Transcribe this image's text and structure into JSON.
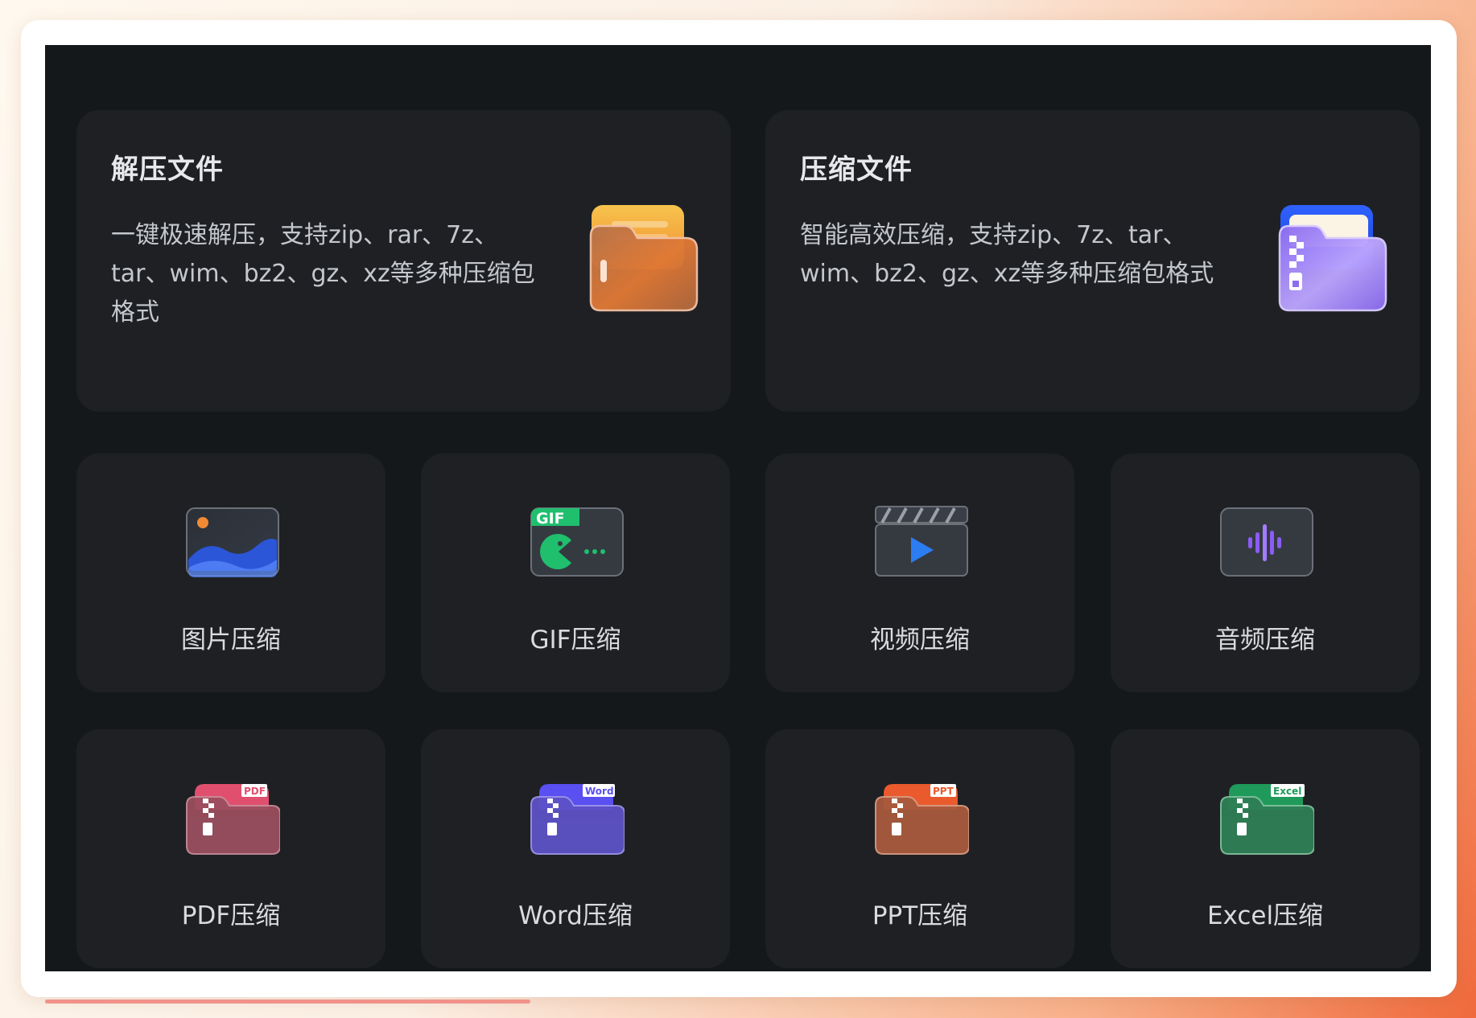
{
  "big_cards": [
    {
      "title": "解压文件",
      "desc": "一键极速解压，支持zip、rar、7z、tar、wim、bz2、gz、xz等多种压缩包格式",
      "icon": "folder-open-icon",
      "color": "#ef7a35"
    },
    {
      "title": "压缩文件",
      "desc": "智能高效压缩，支持zip、7z、tar、wim、bz2、gz、xz等多种压缩包格式",
      "icon": "zip-folder-icon",
      "color": "#9d7dff"
    }
  ],
  "tools": [
    {
      "label": "图片压缩",
      "icon": "image-icon",
      "color": "#3a6ef0"
    },
    {
      "label": "GIF压缩",
      "icon": "gif-icon",
      "badge": "GIF",
      "color": "#1fbf6e"
    },
    {
      "label": "视频压缩",
      "icon": "video-icon",
      "color": "#2c7cf2"
    },
    {
      "label": "音频压缩",
      "icon": "audio-icon",
      "color": "#8b5cf6"
    },
    {
      "label": "PDF压缩",
      "icon": "pdf-zip-icon",
      "badge": "PDF",
      "color": "#e0506e"
    },
    {
      "label": "Word压缩",
      "icon": "word-zip-icon",
      "badge": "Word",
      "color": "#5a4ff0"
    },
    {
      "label": "PPT压缩",
      "icon": "ppt-zip-icon",
      "badge": "PPT",
      "color": "#ea5a2c"
    },
    {
      "label": "Excel压缩",
      "icon": "excel-zip-icon",
      "badge": "Excel",
      "color": "#1f9a5a"
    }
  ],
  "scroll_progress": 0.35
}
